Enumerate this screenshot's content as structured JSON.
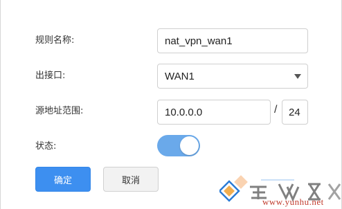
{
  "form": {
    "rule_name": {
      "label": "规则名称:",
      "value": "nat_vpn_wan1"
    },
    "out_interface": {
      "label": "出接口:",
      "value": "WAN1"
    },
    "source_range": {
      "label": "源地址范围:",
      "ip": "10.0.0.0",
      "separator": "/",
      "mask": "24"
    },
    "status": {
      "label": "状态:",
      "enabled": true
    }
  },
  "buttons": {
    "confirm": "确定",
    "cancel": "取消"
  },
  "watermark": {
    "text": "www.yunhu.net",
    "logo": "logo-icon"
  },
  "colors": {
    "primary": "#3d8ff0",
    "toggle_on": "#6aa9ea",
    "cancel_bg": "#f2f2f2"
  }
}
